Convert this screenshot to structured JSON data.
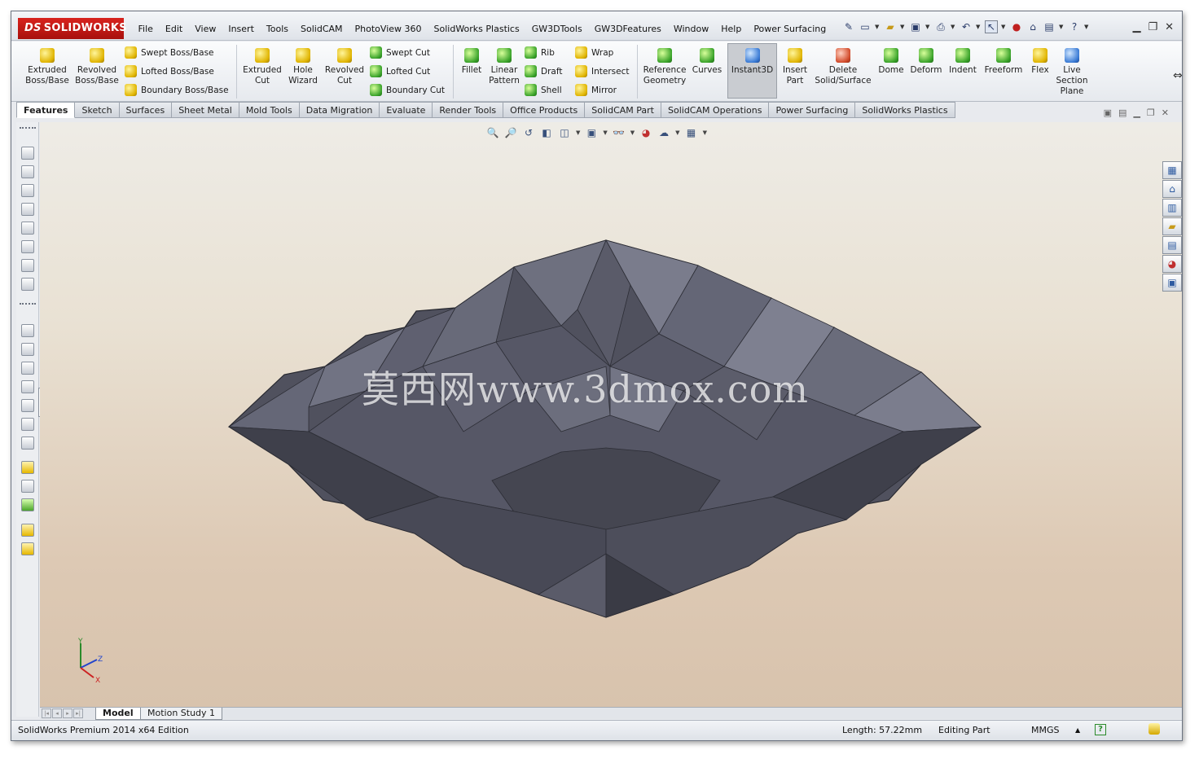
{
  "app": {
    "logo": "SOLIDWORKS",
    "logo_prefix": "DS"
  },
  "menu": [
    "File",
    "Edit",
    "View",
    "Insert",
    "Tools",
    "SolidCAM",
    "PhotoView 360",
    "SolidWorks Plastics",
    "GW3DTools",
    "GW3DFeatures",
    "Window",
    "Help",
    "Power Surfacing"
  ],
  "commands": {
    "extruded_boss": "Extruded Boss/Base",
    "revolved_boss": "Revolved Boss/Base",
    "swept_boss": "Swept Boss/Base",
    "lofted_boss": "Lofted Boss/Base",
    "boundary_boss": "Boundary Boss/Base",
    "extruded_cut": "Extruded Cut",
    "hole_wizard": "Hole Wizard",
    "revolved_cut": "Revolved Cut",
    "swept_cut": "Swept Cut",
    "lofted_cut": "Lofted Cut",
    "boundary_cut": "Boundary Cut",
    "fillet": "Fillet",
    "linear_pattern": "Linear Pattern",
    "rib": "Rib",
    "draft": "Draft",
    "shell": "Shell",
    "wrap": "Wrap",
    "intersect": "Intersect",
    "mirror": "Mirror",
    "reference_geometry": "Reference Geometry",
    "curves": "Curves",
    "instant3d": "Instant3D",
    "insert_part": "Insert Part",
    "delete_solid": "Delete Solid/Surface",
    "dome": "Dome",
    "deform": "Deform",
    "indent": "Indent",
    "freeform": "Freeform",
    "flex": "Flex",
    "live_section": "Live Section Plane"
  },
  "tabs": [
    "Features",
    "Sketch",
    "Surfaces",
    "Sheet Metal",
    "Mold Tools",
    "Data Migration",
    "Evaluate",
    "Render Tools",
    "Office Products",
    "SolidCAM Part",
    "SolidCAM Operations",
    "Power Surfacing",
    "SolidWorks Plastics"
  ],
  "active_tab": "Features",
  "watermark": "莫西网www.3dmox.com",
  "triad": {
    "x": "X",
    "y": "Y",
    "z": "Z"
  },
  "bottom_tabs": {
    "model": "Model",
    "motion": "Motion Study 1"
  },
  "status": {
    "edition": "SolidWorks Premium 2014 x64 Edition",
    "length": "Length: 57.22mm",
    "mode": "Editing Part",
    "units": "MMGS",
    "units_arrow": "▲",
    "help": "?"
  },
  "colors": {
    "model_face_dark": "#4a4b57",
    "model_face_mid": "#5d5e6c",
    "model_face_light": "#7a7c8c",
    "logo_red": "#c8191a"
  }
}
